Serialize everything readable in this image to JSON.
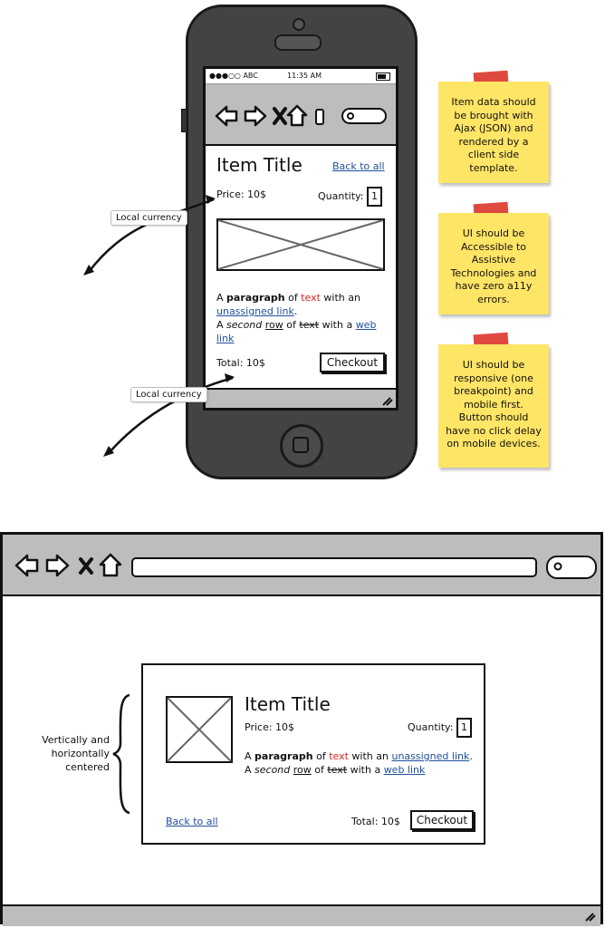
{
  "phone": {
    "status_bar": {
      "carrier": "●●●○○ ABC",
      "time": "11:35 AM"
    },
    "item": {
      "title": "Item Title",
      "back_link": "Back to all",
      "price": "Price: 10$",
      "quantity_label": "Quantity:",
      "quantity_value": "1",
      "paragraph": {
        "a": "A ",
        "bold": "paragraph",
        "of": " of ",
        "red": "text",
        "with_an": " with an ",
        "link1": "unassigned link",
        "period": ".",
        "a2": "A ",
        "italic": "second",
        "sp": " ",
        "underline": "row",
        "of2": " of ",
        "strike": "text",
        "with_a": " with a ",
        "link2": "web link"
      },
      "total": "Total: 10$",
      "checkout": "Checkout"
    }
  },
  "callouts": {
    "local_currency_1": "Local currency",
    "local_currency_2": "Local currency"
  },
  "stickies": [
    "Item data should be brought with Ajax (JSON) and rendered by a client side template.",
    "UI should be Accessible to Assistive Technologies and have zero a11y errors.",
    "UI should be responsive (one breakpoint) and mobile first. Button should have no click delay on mobile devices."
  ],
  "browser": {
    "annotation": "Vertically and horizontally centered",
    "item": {
      "title": "Item Title",
      "price": "Price: 10$",
      "quantity_label": "Quantity:",
      "quantity_value": "1",
      "back_link": "Back to all",
      "total": "Total: 10$",
      "checkout": "Checkout"
    }
  },
  "icons": [
    "back-arrow-icon",
    "forward-arrow-icon",
    "close-icon",
    "home-icon",
    "bookmark-icon",
    "search-icon",
    "resize-grip-icon",
    "image-placeholder-icon",
    "curly-brace-icon"
  ],
  "colors": {
    "sticky": "#ffe566",
    "tape": "#e0493f",
    "link": "#1f4f9c",
    "red_text": "#dd2222",
    "chrome": "#bdbdbd",
    "phone_body": "#434343"
  }
}
